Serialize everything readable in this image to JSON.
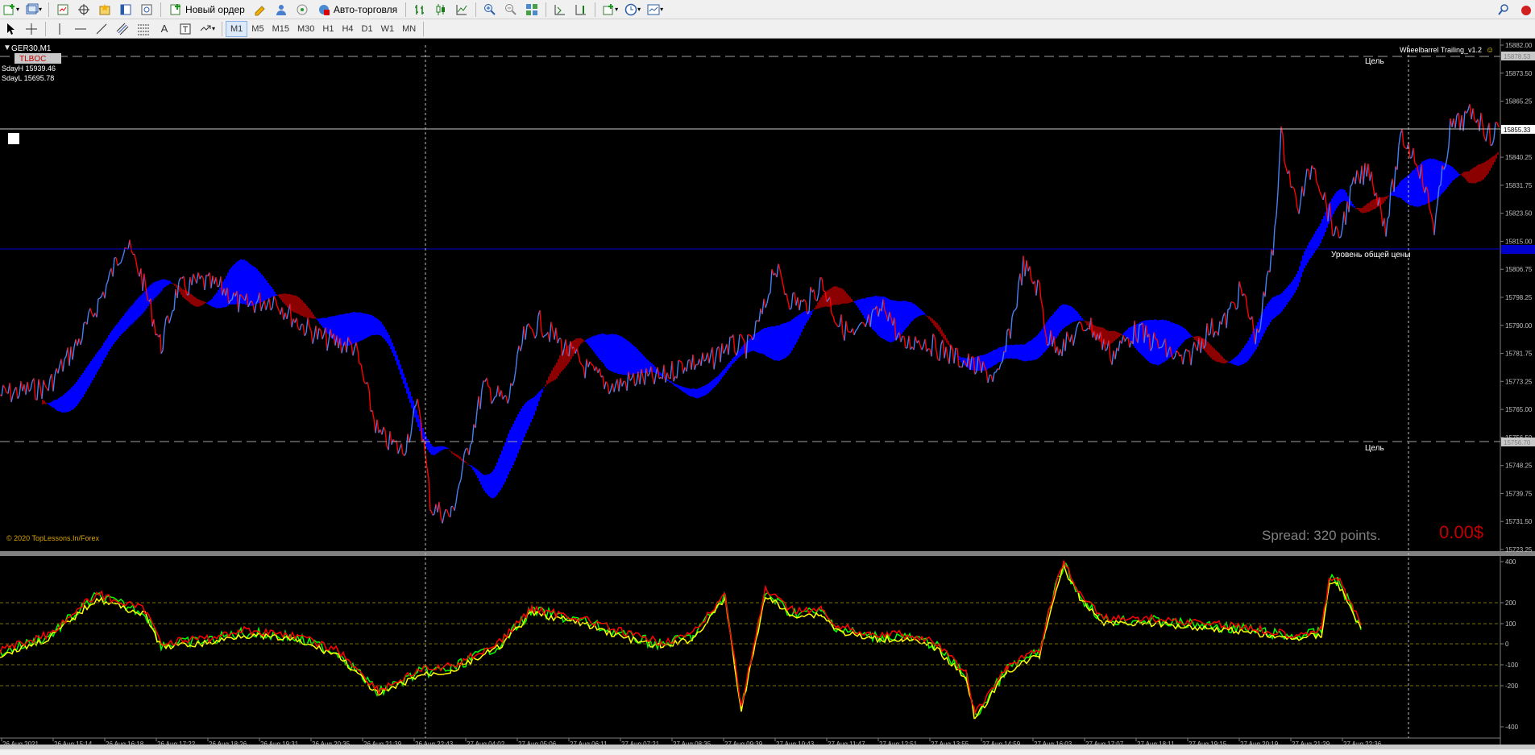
{
  "toolbar": {
    "new_order_label": "Новый ордер",
    "auto_trading_label": "Авто-торговля",
    "timeframes": [
      "M1",
      "M5",
      "M15",
      "M30",
      "H1",
      "H4",
      "D1",
      "W1",
      "MN"
    ],
    "active_timeframe": "M1"
  },
  "chart": {
    "symbol_title": "GER30,M1",
    "indicator_badge": "TLBOC",
    "sday_high": "SdayH 15939.46",
    "sday_low": "SdayL 15695.78",
    "ea_name": "Wheelbarrel Trailing_v1.2",
    "target_label_top": "Цель",
    "target_label_bottom": "Цель",
    "avg_price_label": "Уровень общей цены",
    "copyright": "© 2020 TopLessons.In/Forex",
    "spread": "Spread: 320 points.",
    "profit": "0.00$",
    "price_ticks": [
      "15882.00",
      "15873.50",
      "15865.25",
      "15848.50",
      "15840.25",
      "15831.75",
      "15823.50",
      "15815.00",
      "15806.75",
      "15798.25",
      "15790.00",
      "15781.75",
      "15773.25",
      "15765.00",
      "15756.50",
      "15748.25",
      "15739.75",
      "15731.50",
      "15723.25"
    ],
    "price_labels": {
      "top_target": "15878.53",
      "current": "15855.33",
      "bottom_target": "15756.70"
    },
    "osc_ticks": [
      "400",
      "200",
      "100",
      "0",
      "-100",
      "-200",
      "400"
    ],
    "time_ticks": [
      "26 Aug 2021",
      "26 Aug 15:14",
      "26 Aug 16:18",
      "26 Aug 17:22",
      "26 Aug 18:26",
      "26 Aug 19:31",
      "26 Aug 20:35",
      "26 Aug 21:39",
      "26 Aug 22:43",
      "27 Aug 04:02",
      "27 Aug 05:06",
      "27 Aug 06:11",
      "27 Aug 07:21",
      "27 Aug 08:35",
      "27 Aug 09:39",
      "27 Aug 10:43",
      "27 Aug 11:47",
      "27 Aug 12:51",
      "27 Aug 13:55",
      "27 Aug 14:59",
      "27 Aug 16:03",
      "27 Aug 17:07",
      "27 Aug 18:11",
      "27 Aug 19:15",
      "27 Aug 20:19",
      "27 Aug 21:29",
      "27 Aug 22:36"
    ],
    "colors": {
      "bg": "#000000",
      "cloud_bull": "#0000ff",
      "cloud_bear": "#8b0000",
      "price_up": "#4a7ff0",
      "price_down": "#ff0000",
      "osc_green": "#00ff00",
      "osc_yellow": "#ffff00",
      "osc_red": "#ff0000",
      "spread_text": "#808080",
      "profit_text": "#c00000",
      "copyright_text": "#d7a200",
      "avg_line": "#0000cd"
    }
  }
}
